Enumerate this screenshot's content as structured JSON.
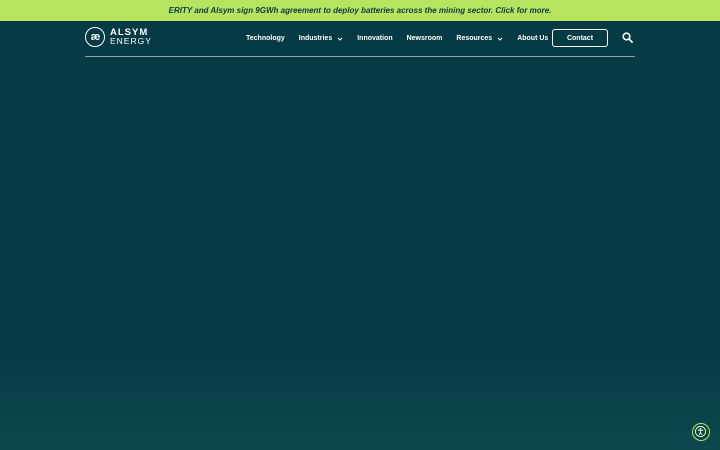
{
  "announcement": {
    "text": "ERITY and Alsym sign 9GWh agreement to deploy batteries across the mining sector. Click for more."
  },
  "logo": {
    "mark": "æ",
    "line1": "ALSYM",
    "line2": "ENERGY"
  },
  "nav": {
    "items": [
      {
        "label": "Technology"
      },
      {
        "label": "Industries"
      },
      {
        "label": "Innovation"
      },
      {
        "label": "Newsroom"
      },
      {
        "label": "Resources"
      },
      {
        "label": "About Us"
      }
    ],
    "contact_label": "Contact"
  },
  "icons": {
    "search": "search-icon",
    "chevron": "chevron-down-icon",
    "accessibility": "accessibility-icon"
  },
  "colors": {
    "announcement_bg": "#b6e45f",
    "page_bg": "#063a45",
    "accent": "#b6e45f"
  }
}
